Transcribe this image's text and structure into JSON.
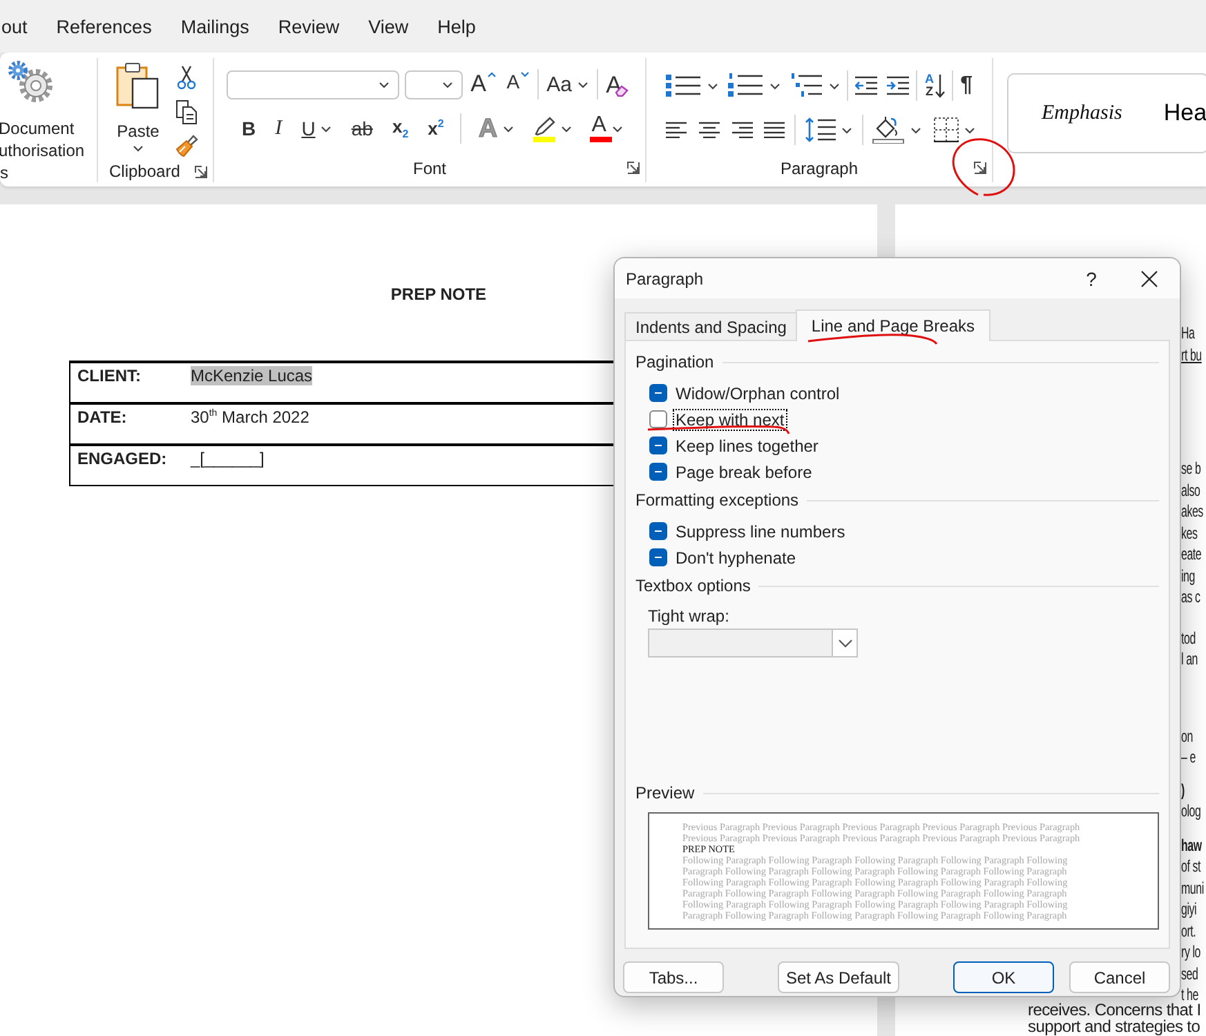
{
  "menu_tabs": [
    "out",
    "References",
    "Mailings",
    "Review",
    "View",
    "Help"
  ],
  "ribbon": {
    "groups": [
      {
        "kind": "custom",
        "label": "s",
        "button": [
          "Document",
          "uthorisation"
        ]
      },
      {
        "kind": "clipboard",
        "label": "Clipboard",
        "paste": "Paste",
        "launcher": true
      },
      {
        "kind": "font",
        "label": "Font",
        "launcher": true,
        "row1": [
          {
            "kind": "font-name"
          },
          {
            "kind": "font-size"
          },
          {
            "kind": "grow",
            "glyph": "A"
          },
          {
            "kind": "shrink",
            "glyph": "A"
          },
          {
            "kind": "separator"
          },
          {
            "kind": "change-case",
            "glyph": "Aa",
            "caret": true
          },
          {
            "kind": "separator"
          },
          {
            "kind": "clear",
            "glyph": "A"
          }
        ],
        "row2": [
          {
            "kind": "bold",
            "glyph": "B"
          },
          {
            "kind": "italic",
            "glyph": "I"
          },
          {
            "kind": "underline",
            "glyph": "U",
            "caret": true
          },
          {
            "kind": "strike",
            "glyph": "ab"
          },
          {
            "kind": "subscript",
            "glyph": "x$_{2}$"
          },
          {
            "kind": "superscript",
            "glyph": "x$^{2}$"
          },
          {
            "kind": "separator"
          },
          {
            "kind": "effects",
            "glyph": "A",
            "caret": true
          },
          {
            "kind": "highlight",
            "color": "#ffff00",
            "caret": true
          },
          {
            "kind": "font-color",
            "glyph": "A",
            "color": "#ff0000",
            "caret": true
          }
        ]
      },
      {
        "kind": "paragraph",
        "label": "Paragraph",
        "launcher": true,
        "row1": [
          {
            "kind": "bullets",
            "caret": true
          },
          {
            "kind": "numbering",
            "caret": true
          },
          {
            "kind": "multilevel",
            "caret": true
          },
          {
            "kind": "separator"
          },
          {
            "kind": "outdent"
          },
          {
            "kind": "indent"
          },
          {
            "kind": "separator"
          },
          {
            "kind": "sort",
            "letters": [
              "A",
              "Z"
            ]
          },
          {
            "kind": "separator"
          },
          {
            "kind": "pilcrow",
            "glyph": "¶"
          }
        ],
        "row2": [
          {
            "kind": "align-left"
          },
          {
            "kind": "align-center"
          },
          {
            "kind": "align-right"
          },
          {
            "kind": "justify"
          },
          {
            "kind": "separator"
          },
          {
            "kind": "spacing",
            "caret": true
          },
          {
            "kind": "separator"
          },
          {
            "kind": "shading",
            "caret": true
          },
          {
            "kind": "borders",
            "caret": true
          }
        ]
      },
      {
        "kind": "styles",
        "items": [
          {
            "kind": "emphasis",
            "label": "Emphasis"
          },
          {
            "kind": "heading",
            "label": "Hea"
          }
        ]
      }
    ]
  },
  "document": {
    "left_page": {
      "title": "PREP NOTE",
      "rows": [
        {
          "label": "CLIENT:",
          "value": "McKenzie Lucas",
          "highlighted": true
        },
        {
          "label": "DATE:",
          "value": "30$^{th}$ March 2022",
          "highlighted": false
        },
        {
          "label": "ENGAGED:",
          "value": "_[______]",
          "highlighted": false
        }
      ]
    },
    "right_page": {
      "fragments": [
        [
          {
            "text": "Ha",
            "kind": "plain"
          },
          {
            "text": "rt bu",
            "kind": "link"
          }
        ],
        [
          {
            "text": "se b",
            "kind": "plain"
          },
          {
            "text": "also",
            "kind": "plain"
          },
          {
            "text": "akes",
            "kind": "plain"
          },
          {
            "text": "kes",
            "kind": "plain"
          },
          {
            "text": "eate",
            "kind": "plain"
          },
          {
            "text": "ing",
            "kind": "plain"
          },
          {
            "text": "as c",
            "kind": "plain"
          }
        ],
        [
          {
            "text": "tod",
            "kind": "plain"
          },
          {
            "text": "l an",
            "kind": "plain"
          }
        ],
        [
          {
            "text": "on",
            "kind": "plain"
          },
          {
            "text": "– e",
            "kind": "plain"
          }
        ],
        [
          {
            "text": ")",
            "kind": "bold"
          },
          {
            "text": "olog",
            "kind": "plain"
          }
        ],
        [
          {
            "text": "haw",
            "kind": "bold"
          },
          {
            "text": "of st",
            "kind": "plain"
          },
          {
            "text": "muni",
            "kind": "plain"
          },
          {
            "text": "giyi",
            "kind": "plain"
          },
          {
            "text": "ort.",
            "kind": "plain"
          },
          {
            "text": "ry lo",
            "kind": "plain"
          },
          {
            "text": "sed",
            "kind": "plain"
          },
          {
            "text": "t he",
            "kind": "plain"
          }
        ]
      ],
      "lines": [
        "receives. Concerns that I",
        "support and strategies to"
      ]
    }
  },
  "dialog": {
    "title": "Paragraph",
    "help": "?",
    "tabs": [
      {
        "label": "Indents and Spacing",
        "selected": false
      },
      {
        "label": "Line and Page Breaks",
        "selected": true
      }
    ],
    "sections": [
      {
        "title": "Pagination",
        "options": [
          {
            "label": "Widow/Orphan control",
            "indeterminate": true,
            "focused": false
          },
          {
            "label": "Keep with next",
            "indeterminate": false,
            "focused": true
          },
          {
            "label": "Keep lines together",
            "indeterminate": true,
            "focused": false
          },
          {
            "label": "Page break before",
            "indeterminate": true,
            "focused": false
          }
        ]
      },
      {
        "title": "Formatting exceptions",
        "options": [
          {
            "label": "Suppress line numbers",
            "indeterminate": true,
            "focused": false
          },
          {
            "label": "Don't hyphenate",
            "indeterminate": true,
            "focused": false
          }
        ]
      },
      {
        "title": "Textbox options",
        "field": {
          "label": "Tight wrap:",
          "disabled": true
        }
      }
    ],
    "preview": {
      "title": "Preview",
      "previous": [
        "Previous Paragraph Previous Paragraph Previous Paragraph Previous Paragraph Previous Paragraph",
        "Previous Paragraph Previous Paragraph Previous Paragraph Previous Paragraph Previous Paragraph"
      ],
      "current": "PREP NOTE",
      "following": [
        "Following Paragraph Following Paragraph Following Paragraph Following Paragraph Following",
        "Paragraph Following Paragraph Following Paragraph Following Paragraph Following Paragraph",
        "Following Paragraph Following Paragraph Following Paragraph Following Paragraph Following",
        "Paragraph Following Paragraph Following Paragraph Following Paragraph Following Paragraph",
        "Following Paragraph Following Paragraph Following Paragraph Following Paragraph Following",
        "Paragraph Following Paragraph Following Paragraph Following Paragraph Following Paragraph"
      ]
    },
    "buttons": [
      {
        "label": "Tabs...",
        "default": false
      },
      {
        "label": "Set As Default",
        "default": false
      },
      {
        "label": "OK",
        "default": true
      },
      {
        "label": "Cancel",
        "default": false
      }
    ]
  }
}
